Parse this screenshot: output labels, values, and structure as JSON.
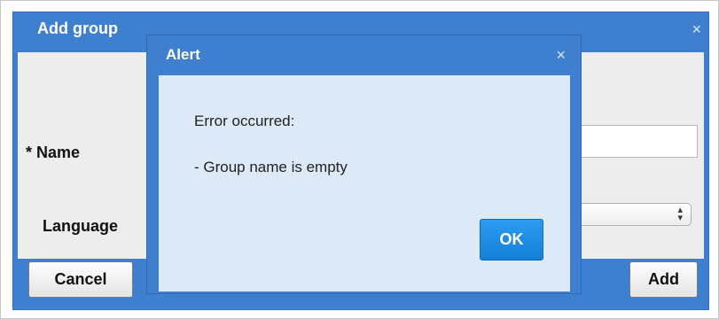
{
  "add_group_dialog": {
    "title": "Add group",
    "close_glyph": "×",
    "fields": {
      "name_label": "* Name",
      "name_value": "",
      "language_label": "Language",
      "language_selected": ""
    },
    "buttons": {
      "cancel_label": "Cancel",
      "add_label": "Add"
    }
  },
  "alert_dialog": {
    "title": "Alert",
    "close_glyph": "×",
    "message_heading": "Error occurred:",
    "message_detail": "- Group name is empty",
    "ok_label": "OK"
  },
  "colors": {
    "dialog_header_blue": "#3f7fd0",
    "alert_body": "#dde9f7",
    "ok_button": "#1e8fe6",
    "form_body": "#ededed"
  },
  "icons": {
    "outer_close": "close-icon",
    "alert_close": "close-icon",
    "select_arrows": "select-arrows-icon"
  }
}
